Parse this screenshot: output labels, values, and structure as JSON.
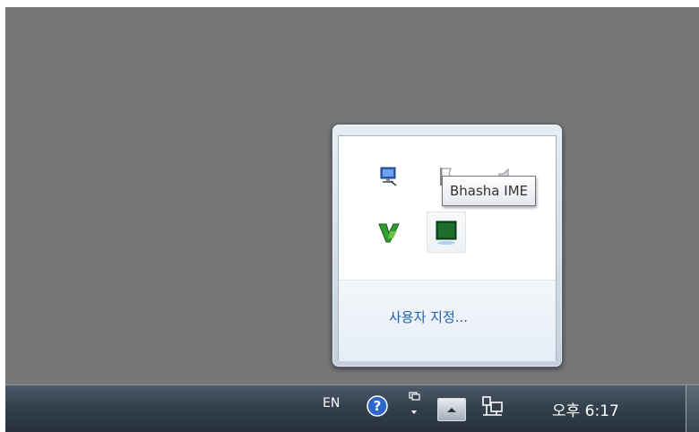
{
  "flyout": {
    "icons": [
      {
        "name": "network-icon"
      },
      {
        "name": "action-center-flag-icon"
      },
      {
        "name": "volume-icon"
      },
      {
        "name": "vim-icon"
      },
      {
        "name": "bhasha-ime-icon"
      }
    ],
    "customize_label": "사용자 지정..."
  },
  "tooltip": {
    "text": "Bhasha IME"
  },
  "taskbar": {
    "language": "EN",
    "clock": "오후 6:17",
    "icons": [
      "help-icon",
      "ime-options-icon",
      "show-hidden-icons-button",
      "network-icon"
    ]
  },
  "colors": {
    "desktop": "#777777",
    "taskbar": "#33404d",
    "link": "#1f61a8"
  }
}
